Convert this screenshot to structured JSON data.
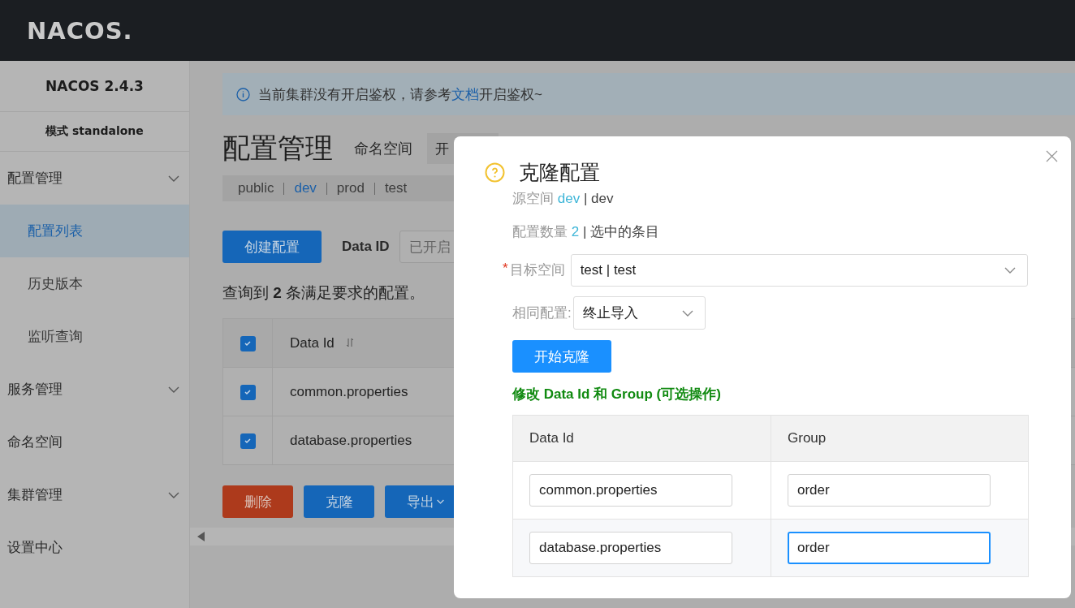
{
  "header": {
    "logo": "NACOS."
  },
  "sidebar": {
    "version": "NACOS 2.4.3",
    "mode": "模式 standalone",
    "items": [
      {
        "label": "配置管理",
        "kind": "group",
        "children": [
          {
            "label": "配置列表",
            "selected": true
          },
          {
            "label": "历史版本",
            "selected": false
          },
          {
            "label": "监听查询",
            "selected": false
          }
        ]
      },
      {
        "label": "服务管理",
        "kind": "group"
      },
      {
        "label": "命名空间",
        "kind": "link"
      },
      {
        "label": "集群管理",
        "kind": "group"
      },
      {
        "label": "设置中心",
        "kind": "link"
      }
    ]
  },
  "main": {
    "notice": {
      "before": "当前集群没有开启鉴权，请参考",
      "link": "文档",
      "after": "开启鉴权~"
    },
    "title": "配置管理",
    "namespace_label": "命名空间",
    "namespace_select": "开",
    "namespaces": [
      {
        "label": "public",
        "selected": false
      },
      {
        "label": "dev",
        "selected": true
      },
      {
        "label": "prod",
        "selected": false
      },
      {
        "label": "test",
        "selected": false
      }
    ],
    "create_button": "创建配置",
    "filter_label": "Data ID",
    "filter_placeholder": "已开启",
    "summary": "查询到 **2** 条满足要求的配置。",
    "table": {
      "header_checked": true,
      "columns": [
        "Data Id"
      ],
      "rows": [
        {
          "data_id": "common.properties",
          "checked": true
        },
        {
          "data_id": "database.properties",
          "checked": true
        }
      ]
    },
    "actions": [
      {
        "label": "删除",
        "kind": "danger"
      },
      {
        "label": "克隆",
        "kind": "primary"
      },
      {
        "label": "导出",
        "kind": "dropdown"
      }
    ]
  },
  "dialog": {
    "title": "克隆配置",
    "source_label": "源空间",
    "source_id": "dev",
    "source_name": "| dev",
    "count_label": "配置数量",
    "count": "2",
    "count_suffix": "| 选中的条目",
    "required_mark": "*",
    "target_label": "目标空间",
    "target_value": "test | test",
    "policy_label": "相同配置:",
    "policy_value": "终止导入",
    "start_button": "开始克隆",
    "edit_hint": "修改 Data Id 和 Group (可选操作)",
    "columns": [
      "Data Id",
      "Group"
    ],
    "rows": [
      {
        "data_id": "common.properties",
        "group": "order",
        "focused": false
      },
      {
        "data_id": "database.properties",
        "group": "order",
        "focused": true
      }
    ]
  }
}
